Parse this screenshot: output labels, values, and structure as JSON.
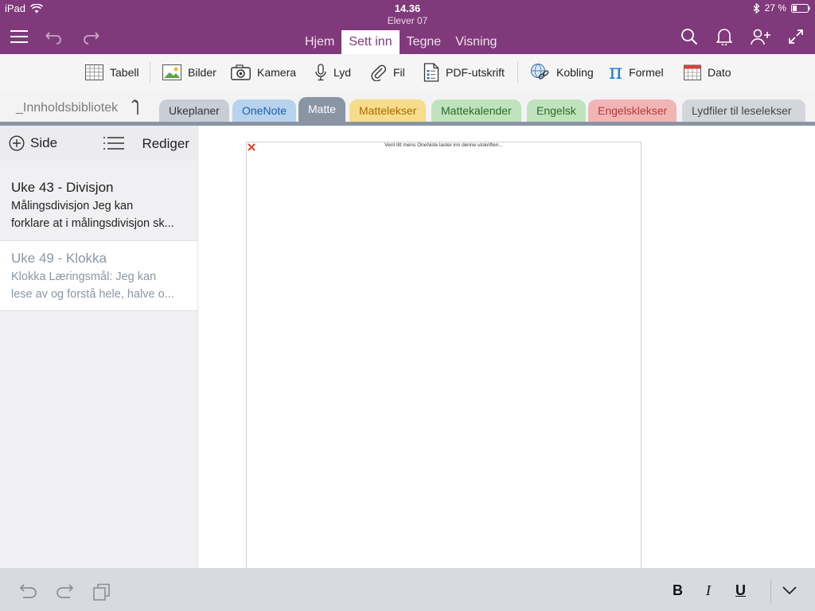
{
  "status": {
    "device": "iPad",
    "time": "14.36",
    "subtitle": "Elever 07",
    "battery": "27 %"
  },
  "nav": {
    "tabs": [
      {
        "label": "Hjem",
        "active": false
      },
      {
        "label": "Sett inn",
        "active": true
      },
      {
        "label": "Tegne",
        "active": false
      },
      {
        "label": "Visning",
        "active": false
      }
    ]
  },
  "ribbon": {
    "table": "Tabell",
    "images": "Bilder",
    "camera": "Kamera",
    "audio": "Lyd",
    "file": "Fil",
    "pdf": "PDF-utskrift",
    "link": "Kobling",
    "formula": "Formel",
    "date": "Dato"
  },
  "library": {
    "name": "_Innholdsbibliotek"
  },
  "sections": [
    {
      "label": "Ukeplaner",
      "bg": "#c8ced6",
      "fg": "#333333"
    },
    {
      "label": "OneNote",
      "bg": "#b7d3ee",
      "fg": "#1f5fa8"
    },
    {
      "label": "Matte",
      "bg": "#8995a3",
      "fg": "#ffffff"
    },
    {
      "label": "Mattelekser",
      "bg": "#f6dc8b",
      "fg": "#a86b00"
    },
    {
      "label": "Mattekalender",
      "bg": "#bfe3bd",
      "fg": "#2a6b2a"
    },
    {
      "label": "Engelsk",
      "bg": "#bfe3bd",
      "fg": "#2a6b2a"
    },
    {
      "label": "Engelsklekser",
      "bg": "#f2b5b5",
      "fg": "#b23a3a"
    },
    {
      "label": "Lydfiler til leselekser",
      "bg": "#d3d7dc",
      "fg": "#444444"
    }
  ],
  "pagelist": {
    "add_label": "Side",
    "edit_label": "Rediger",
    "pages": [
      {
        "title": "Uke 43 - Divisjon",
        "line1": "Målingsdivisjon  Jeg kan",
        "line2": "forklare at i målingsdivisjon sk..."
      },
      {
        "title": "Uke 49 - Klokka",
        "line1": "Klokka  Læringsmål:  Jeg kan",
        "line2": "lese av og forstå hele, halve o..."
      }
    ]
  },
  "canvas": {
    "loading_text": "Vent litt mens OneNote laster inn denne utskriften..."
  },
  "colors": {
    "brand": "#80397b",
    "accent_blue": "#1f7ad6"
  },
  "format": {
    "bold": "B",
    "italic": "I",
    "underline": "U"
  }
}
